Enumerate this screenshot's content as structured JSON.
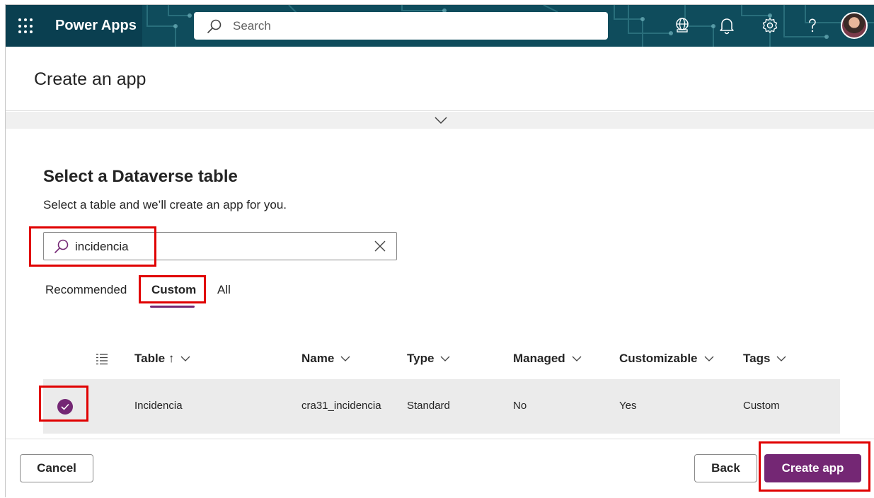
{
  "topbar": {
    "app_name": "Power Apps",
    "search_placeholder": "Search",
    "icons": [
      "waffle-icon",
      "environment-icon",
      "notifications-icon",
      "settings-icon",
      "help-icon",
      "user-avatar"
    ]
  },
  "page": {
    "title": "Create an app"
  },
  "section": {
    "title": "Select a Dataverse table",
    "subtitle": "Select a table and we’ll create an app for you."
  },
  "table_search": {
    "value": "incidencia"
  },
  "tabs": [
    {
      "label": "Recommended",
      "active": false
    },
    {
      "label": "Custom",
      "active": true
    },
    {
      "label": "All",
      "active": false
    }
  ],
  "grid": {
    "columns": [
      "Table ↑",
      "Name",
      "Type",
      "Managed",
      "Customizable",
      "Tags"
    ],
    "rows": [
      {
        "selected": true,
        "table": "Incidencia",
        "name": "cra31_incidencia",
        "type": "Standard",
        "managed": "No",
        "customizable": "Yes",
        "tags": "Custom"
      }
    ]
  },
  "footer": {
    "cancel": "Cancel",
    "back": "Back",
    "create": "Create app"
  },
  "colors": {
    "brand": "#742774",
    "topbar": "#0f4c5c",
    "highlight": "#e00000"
  }
}
